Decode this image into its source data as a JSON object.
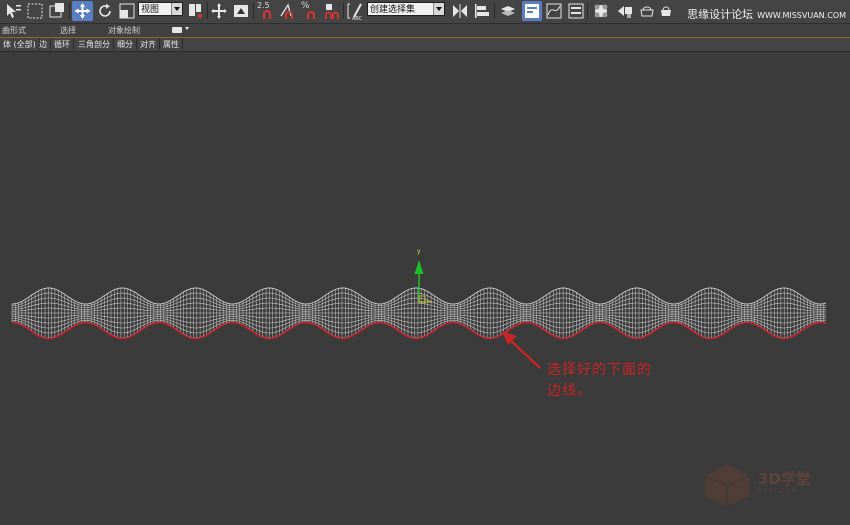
{
  "toolbar": {
    "view_dropdown": "视图",
    "snap_angle_label": "2.5",
    "snap_percent_label": "%",
    "selection_set_dropdown": "创建选择集",
    "watermark": "思缘设计论坛",
    "watermark_site": "WWW.MISSVUAN.COM"
  },
  "ribbon_tabs": {
    "tab1": "曲形式",
    "tab2": "选择",
    "tab3": "对象绘制"
  },
  "ribbon_items": [
    "体 (全部)",
    "边",
    "循环",
    "三角剖分",
    "细分",
    "对齐",
    "属性"
  ],
  "viewport": {
    "gizmo_axis_label": "y",
    "annotation_line1": "选择好的下面的",
    "annotation_line2": "边线。",
    "corner_logo_text": "3D学堂",
    "corner_logo_sub": "3DXT.COM",
    "wire_color": "#e8e8e8",
    "selected_edge_color": "#c0202a",
    "annotation_color": "#c62525"
  }
}
